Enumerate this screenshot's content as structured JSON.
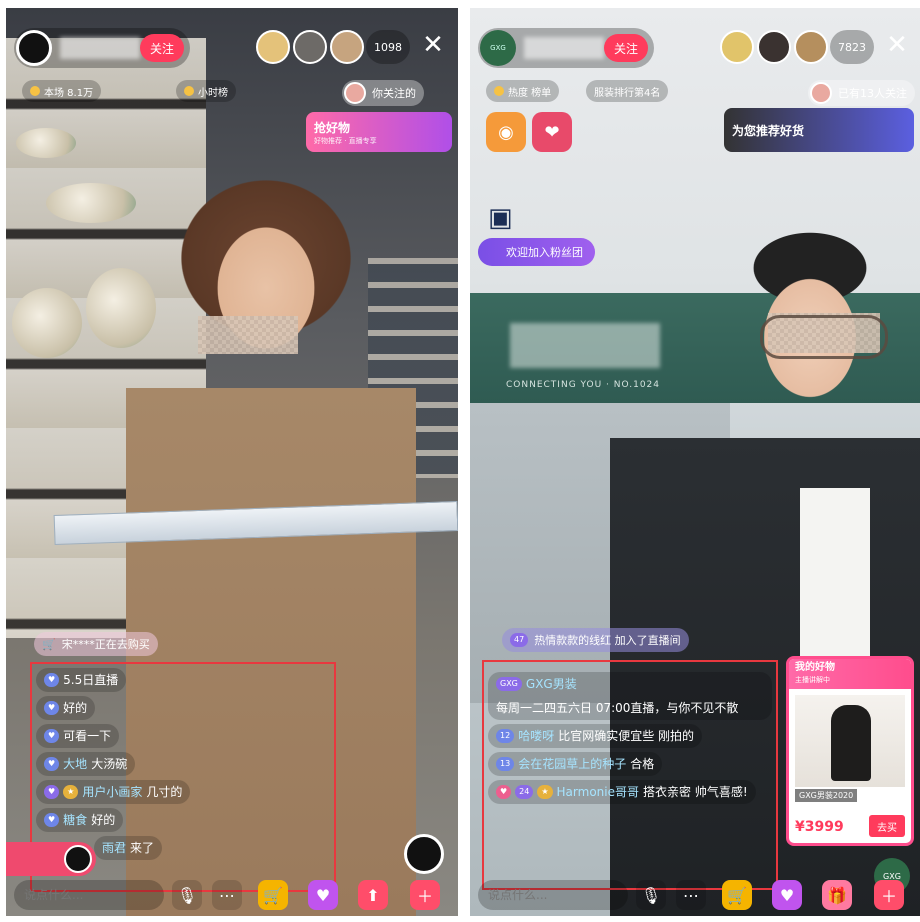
{
  "left": {
    "follow_label": "关注",
    "viewer_count": "1098",
    "close_glyph": "✕",
    "stat_1": "本场 8.1万",
    "stat_2": "小时榜",
    "follow_notice": "你关注的",
    "promo_title": "抢好物",
    "promo_sub": "好物推荐 · 直播专享",
    "purchase_banner": "宋****正在去购买",
    "chat": [
      {
        "badge": "",
        "user": "",
        "text": "5.5日直播"
      },
      {
        "badge": "",
        "user": "",
        "text": "好的"
      },
      {
        "badge": "",
        "user": "",
        "text": "可看一下"
      },
      {
        "badge": "",
        "user": "大地",
        "text": "大汤碗"
      },
      {
        "badge": "",
        "user": "用户小画家",
        "text": "几寸的"
      },
      {
        "badge": "",
        "user": "糖食",
        "text": "好的"
      },
      {
        "badge": "",
        "user": "雨君",
        "text": "来了"
      }
    ],
    "comment_placeholder": "说点什么..."
  },
  "right": {
    "follow_label": "关注",
    "brand_badge": "GXG",
    "viewer_count": "7823",
    "close_glyph": "✕",
    "stat_1": "热度 榜单",
    "stat_2": "服装排行第4名",
    "follow_notice": "已有13人关注",
    "promo_title": "为您推荐好货",
    "fan_welcome": "欢迎加入粉丝团",
    "wall_sub": "CONNECTING YOU · NO.1024",
    "join_banner_level": "47",
    "join_banner": "热情款款的线红 加入了直播间",
    "chat": [
      {
        "badge": "GXG",
        "user": "GXG男装",
        "text": "每周一二四五六日 07:00直播，与你不见不散"
      },
      {
        "badge": "12",
        "user": "哈喽呀",
        "text": "比官网确实便宜些 刚拍的"
      },
      {
        "badge": "13",
        "user": "会在花园草上的种子",
        "text": "合格"
      },
      {
        "badge": "24",
        "user": "Harmonie哥哥",
        "text": "搭衣亲密 帅气喜感!"
      }
    ],
    "product": {
      "head": "我的好物",
      "head_sub": "主播讲解中",
      "tag": "GXG男装2020",
      "price": "¥3999",
      "buy_label": "去买"
    },
    "comment_placeholder": "说点什么..."
  },
  "colors": {
    "accent": "#ff3b5c",
    "highlight_border": "#e8383f",
    "fan_badge": "#7a4fe6"
  }
}
